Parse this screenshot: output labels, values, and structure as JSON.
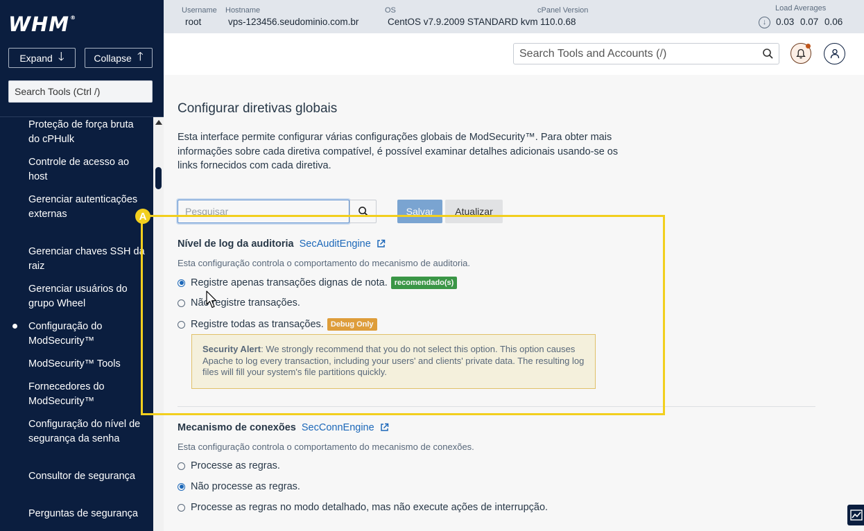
{
  "sidebar": {
    "logo": "WHM",
    "expand_label": "Expand",
    "collapse_label": "Collapse",
    "search_placeholder": "Search Tools (Ctrl /)",
    "items": [
      {
        "label": "Proteção de força bruta do cPHulk"
      },
      {
        "label": "Controle de acesso ao host"
      },
      {
        "label": "Gerenciar autenticações externas"
      },
      {
        "label": "Gerenciar chaves SSH da raiz"
      },
      {
        "label": "Gerenciar usuários do grupo Wheel"
      },
      {
        "label": "Configuração do ModSecurity™",
        "active": true
      },
      {
        "label": "ModSecurity™ Tools"
      },
      {
        "label": "Fornecedores do ModSecurity™"
      },
      {
        "label": "Configuração do nível de segurança da senha"
      },
      {
        "label": "Consultor de segurança"
      },
      {
        "label": "Perguntas de segurança"
      }
    ]
  },
  "topbar": {
    "username_label": "Username",
    "username": "root",
    "hostname_label": "Hostname",
    "hostname": "vps-123456.seudominio.com.br",
    "os_label": "OS",
    "os": "CentOS v7.9.2009 STANDARD kvm",
    "cpanel_label": "cPanel Version",
    "cpanel_version": "110.0.68",
    "load_label": "Load Averages",
    "load": [
      "0.03",
      "0.07",
      "0.06"
    ]
  },
  "header": {
    "search_placeholder": "Search Tools and Accounts (/)",
    "notification_icon": "bell-icon",
    "user_icon": "user-icon"
  },
  "main": {
    "title": "Configurar diretivas globais",
    "intro": "Esta interface permite configurar várias configurações globais de ModSecurity™. Para obter mais informações sobre cada diretiva compatível, é possível examinar detalhes adicionais usando-se os links fornecidos com cada diretiva.",
    "filter_placeholder": "Pesquisar",
    "save_label": "Salvar",
    "refresh_label": "Atualizar",
    "sections": [
      {
        "heading": "Nível de log da auditoria",
        "link": "SecAuditEngine",
        "description": "Esta configuração controla o comportamento do mecanismo de auditoria.",
        "options": [
          {
            "label": "Registre apenas transações dignas de nota.",
            "checked": true,
            "badge": "recomendado(s)"
          },
          {
            "label": "Não registre transações.",
            "checked": false
          },
          {
            "label": "Registre todas as transações.",
            "checked": false,
            "badge": "Debug Only"
          }
        ],
        "alert": {
          "title": "Security Alert",
          "text": ": We strongly recommend that you do not select this option. This option causes Apache to log every transaction, including your users' and clients' private data. The resulting log files will fill your system's file partitions quickly."
        }
      },
      {
        "heading": "Mecanismo de conexões",
        "link": "SecConnEngine",
        "description": "Esta configuração controla o comportamento do mecanismo de conexões.",
        "options": [
          {
            "label": "Processe as regras.",
            "checked": false
          },
          {
            "label": "Não processe as regras.",
            "checked": true
          },
          {
            "label": "Processe as regras no modo detalhado, mas não execute ações de interrupção.",
            "checked": false
          }
        ]
      }
    ]
  },
  "annotation": {
    "marker": "A",
    "color": "#f2cf1e"
  },
  "colors": {
    "sidebar_bg": "#0b1e3f",
    "link": "#1c6bbf",
    "badge_green": "#3c9b48",
    "badge_orange": "#e6a23c",
    "save_button": "#7ea9d8"
  }
}
